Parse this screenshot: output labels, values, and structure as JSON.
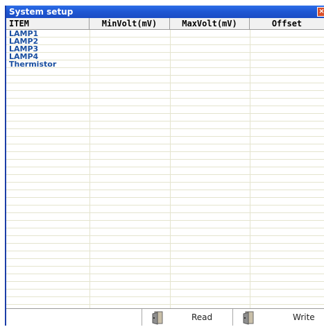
{
  "window": {
    "title": "System setup"
  },
  "table": {
    "columns": [
      "ITEM",
      "MinVolt(mV)",
      "MaxVolt(mV)",
      "Offset"
    ],
    "rows": [
      {
        "item": "LAMP1",
        "min": "",
        "max": "",
        "offset": ""
      },
      {
        "item": "LAMP2",
        "min": "",
        "max": "",
        "offset": ""
      },
      {
        "item": "LAMP3",
        "min": "",
        "max": "",
        "offset": ""
      },
      {
        "item": "LAMP4",
        "min": "",
        "max": "",
        "offset": ""
      },
      {
        "item": "Thermistor",
        "min": "",
        "max": "",
        "offset": ""
      }
    ]
  },
  "footer": {
    "read_label": "Read",
    "write_label": "Write"
  },
  "icons": {
    "close": "close-icon",
    "read": "door-icon",
    "write": "door-icon"
  },
  "colors": {
    "titlebar": "#1f58d4",
    "item_text": "#1a4fa0",
    "grid_line": "#e4e4ce"
  }
}
